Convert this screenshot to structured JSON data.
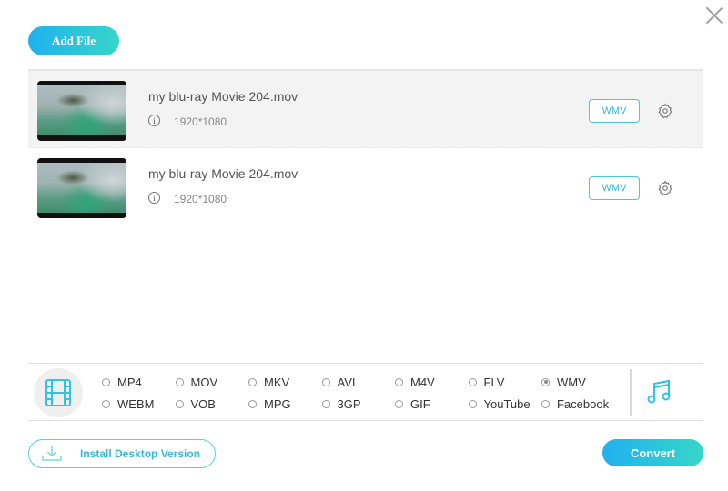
{
  "header": {
    "add_file_label": "Add File",
    "close_icon": "close-icon"
  },
  "files": [
    {
      "name": "my blu-ray Movie 204.mov",
      "resolution": "1920*1080",
      "format": "WMV",
      "selected": true
    },
    {
      "name": "my blu-ray Movie 204.mov",
      "resolution": "1920*1080",
      "format": "WMV",
      "selected": false
    }
  ],
  "formats": {
    "selected": "WMV",
    "options": [
      "MP4",
      "MOV",
      "MKV",
      "AVI",
      "M4V",
      "FLV",
      "WMV",
      "WEBM",
      "VOB",
      "MPG",
      "3GP",
      "GIF",
      "YouTube",
      "Facebook"
    ]
  },
  "footer": {
    "install_label": "Install Desktop Version",
    "convert_label": "Convert"
  },
  "colors": {
    "accent": "#1fb1f0",
    "accent2": "#37d6c9",
    "outline": "#4cc6d9"
  }
}
